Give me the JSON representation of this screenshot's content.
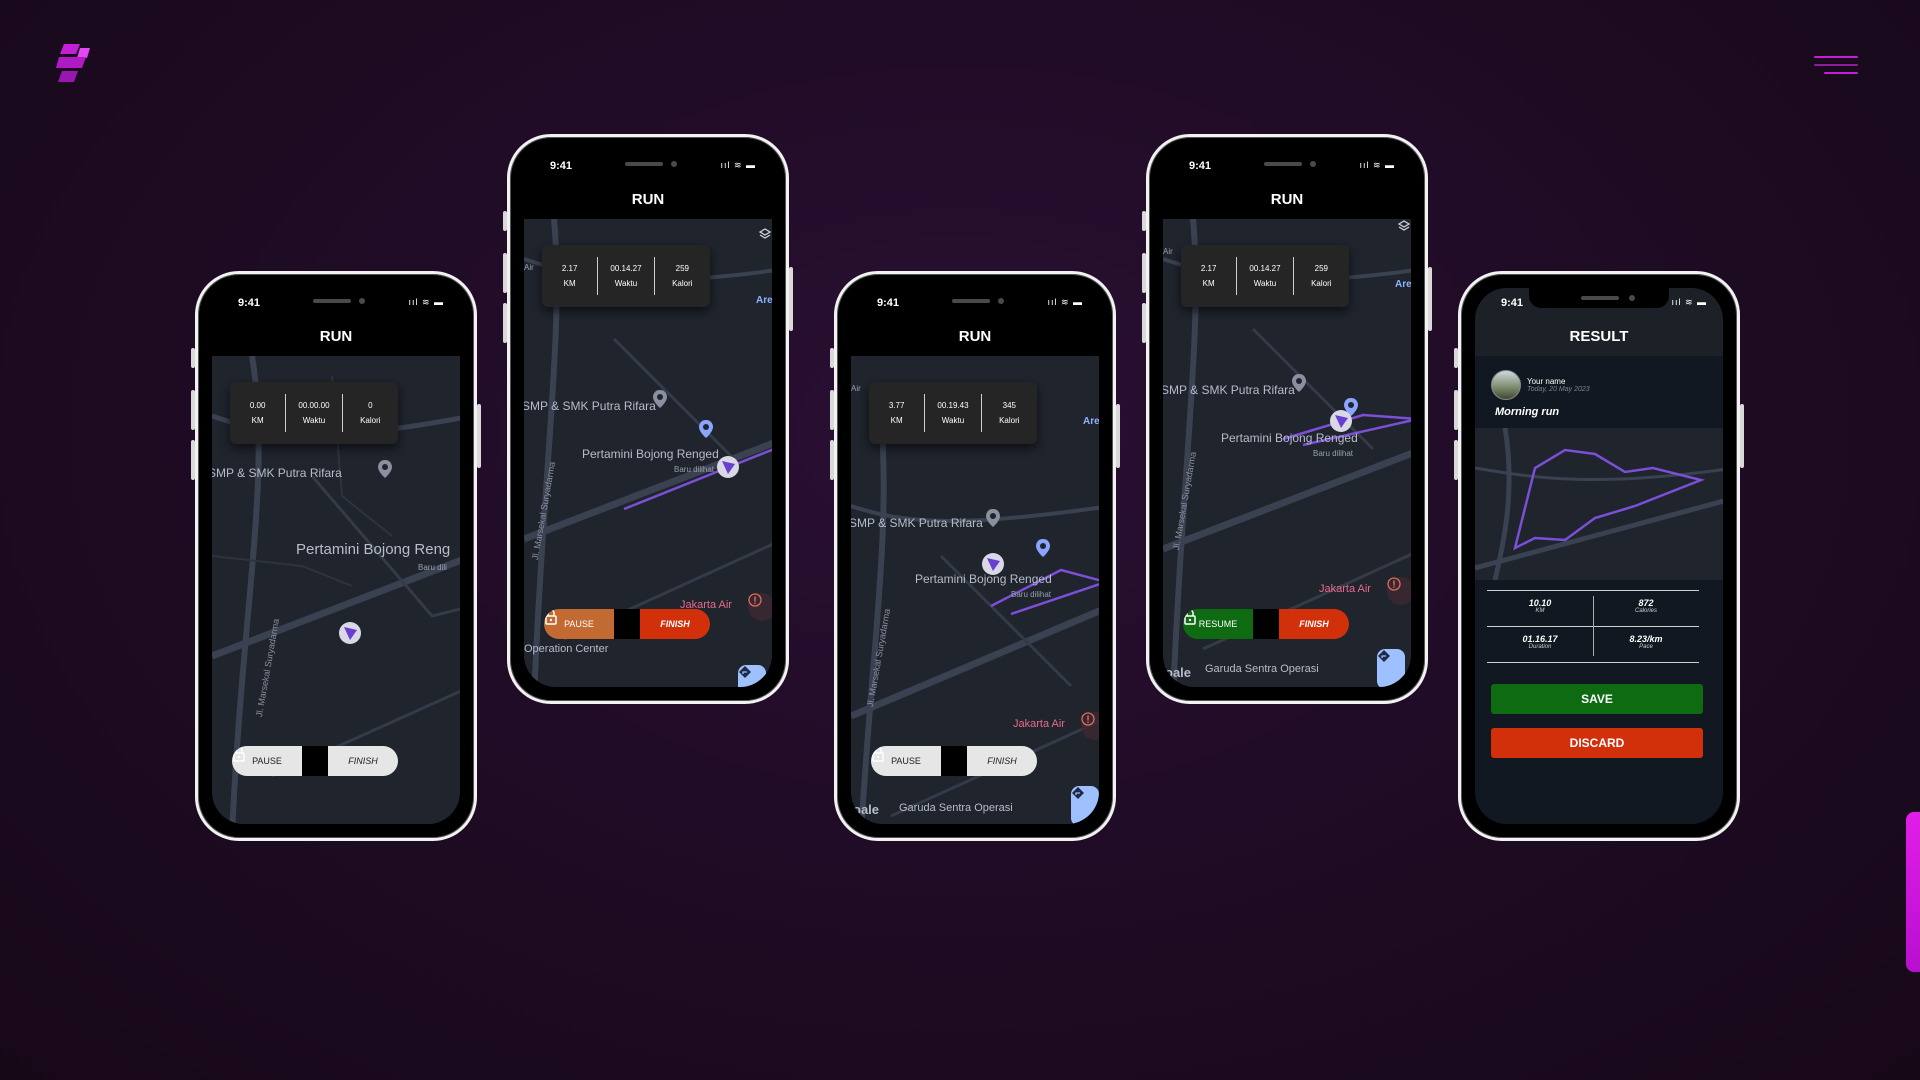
{
  "brand": {
    "logo_icon": "brand-logo-icon",
    "accent": "#c21fd6"
  },
  "header": {
    "menu_icon": "hamburger-menu-icon"
  },
  "status": {
    "time": "9:41",
    "icons": "ııl ≋ ▬"
  },
  "colors": {
    "pause_light": "#e6e6e6",
    "pause_orange": "#c26a32",
    "finish_red": "#d2300a",
    "resume_green": "#0f6b12",
    "save_green": "#0f6b12",
    "discard_red": "#d2300a",
    "route": "#7b4fd6"
  },
  "map_labels": {
    "school": "SMP & SMK Putra Rifara",
    "station": "Pertamini Bojong Renged",
    "station_short": "Pertamini Bojong Reng",
    "baru": "Baru dilihat",
    "baru_short": "Baru dili",
    "road": "Jl. Marsekal Suryadarma",
    "jakarta": "Jakarta Air",
    "ops": "Operation Center",
    "garuda": "Garuda Sentra Operasi",
    "google": "oale",
    "area": "Area",
    "air": "Air"
  },
  "phones": [
    {
      "title": "RUN",
      "stats": [
        {
          "value": "0.00",
          "label": "KM"
        },
        {
          "value": "00.00.00",
          "label": "Waktu"
        },
        {
          "value": "0",
          "label": "Kalori"
        }
      ],
      "left_button": "PAUSE",
      "right_button": "FINISH"
    },
    {
      "title": "RUN",
      "stats": [
        {
          "value": "2.17",
          "label": "KM"
        },
        {
          "value": "00.14.27",
          "label": "Waktu"
        },
        {
          "value": "259",
          "label": "Kalori"
        }
      ],
      "left_button": "PAUSE",
      "right_button": "FINISH"
    },
    {
      "title": "RUN",
      "stats": [
        {
          "value": "3.77",
          "label": "KM"
        },
        {
          "value": "00.19.43",
          "label": "Waktu"
        },
        {
          "value": "345",
          "label": "Kalori"
        }
      ],
      "left_button": "PAUSE",
      "right_button": "FINISH"
    },
    {
      "title": "RUN",
      "stats": [
        {
          "value": "2.17",
          "label": "KM"
        },
        {
          "value": "00.14.27",
          "label": "Waktu"
        },
        {
          "value": "259",
          "label": "Kalori"
        }
      ],
      "left_button": "RESUME",
      "right_button": "FINISH"
    }
  ],
  "result": {
    "title": "RESULT",
    "user_name": "Your name",
    "date": "Today, 20 May 2023",
    "run_title": "Morning run",
    "metrics": [
      {
        "value": "10.10",
        "unit": "KM"
      },
      {
        "value": "872",
        "unit": "Calories"
      },
      {
        "value": "01.16.17",
        "unit": "Duration"
      },
      {
        "value": "8.23/km",
        "unit": "Pace"
      }
    ],
    "save_label": "SAVE",
    "discard_label": "DISCARD"
  }
}
